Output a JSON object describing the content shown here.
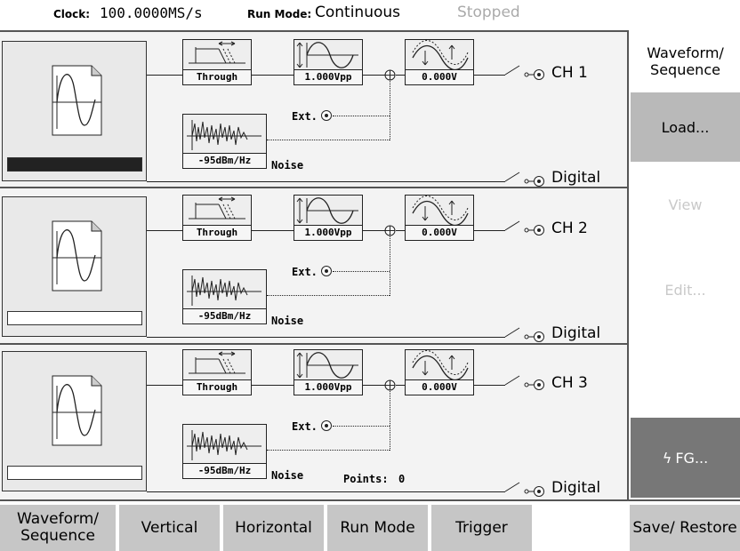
{
  "status": {
    "clock_label": "Clock:",
    "clock_value": "100.0000MS/s",
    "runmode_label": "Run Mode:",
    "runmode_value": "Continuous",
    "state": "Stopped"
  },
  "channels": [
    {
      "filter": "Through",
      "amplitude": "1.000Vpp",
      "offset": "0.000V",
      "noise": "-95dBm/Hz",
      "noise_label": "Noise",
      "ext_label": "Ext.",
      "output": "CH 1",
      "digital": "Digital"
    },
    {
      "filter": "Through",
      "amplitude": "1.000Vpp",
      "offset": "0.000V",
      "noise": "-95dBm/Hz",
      "noise_label": "Noise",
      "ext_label": "Ext.",
      "output": "CH 2",
      "digital": "Digital"
    },
    {
      "filter": "Through",
      "amplitude": "1.000Vpp",
      "offset": "0.000V",
      "noise": "-95dBm/Hz",
      "noise_label": "Noise",
      "ext_label": "Ext.",
      "output": "CH 3",
      "digital": "Digital"
    }
  ],
  "points_label": "Points:",
  "points_value": "0",
  "side_menu": {
    "title": "Waveform/ Sequence",
    "load": "Load...",
    "view": "View",
    "edit": "Edit...",
    "fg": "FG..."
  },
  "bottom_menu": {
    "waveform_sequence": "Waveform/ Sequence",
    "vertical": "Vertical",
    "horizontal": "Horizontal",
    "run_mode": "Run Mode",
    "trigger": "Trigger",
    "save_restore": "Save/ Restore"
  },
  "colors": {
    "menu_gray": "#c6c6c6",
    "load_gray": "#b9b9b9",
    "fg_dark": "#777777",
    "disabled_text": "#c9c9c9"
  }
}
